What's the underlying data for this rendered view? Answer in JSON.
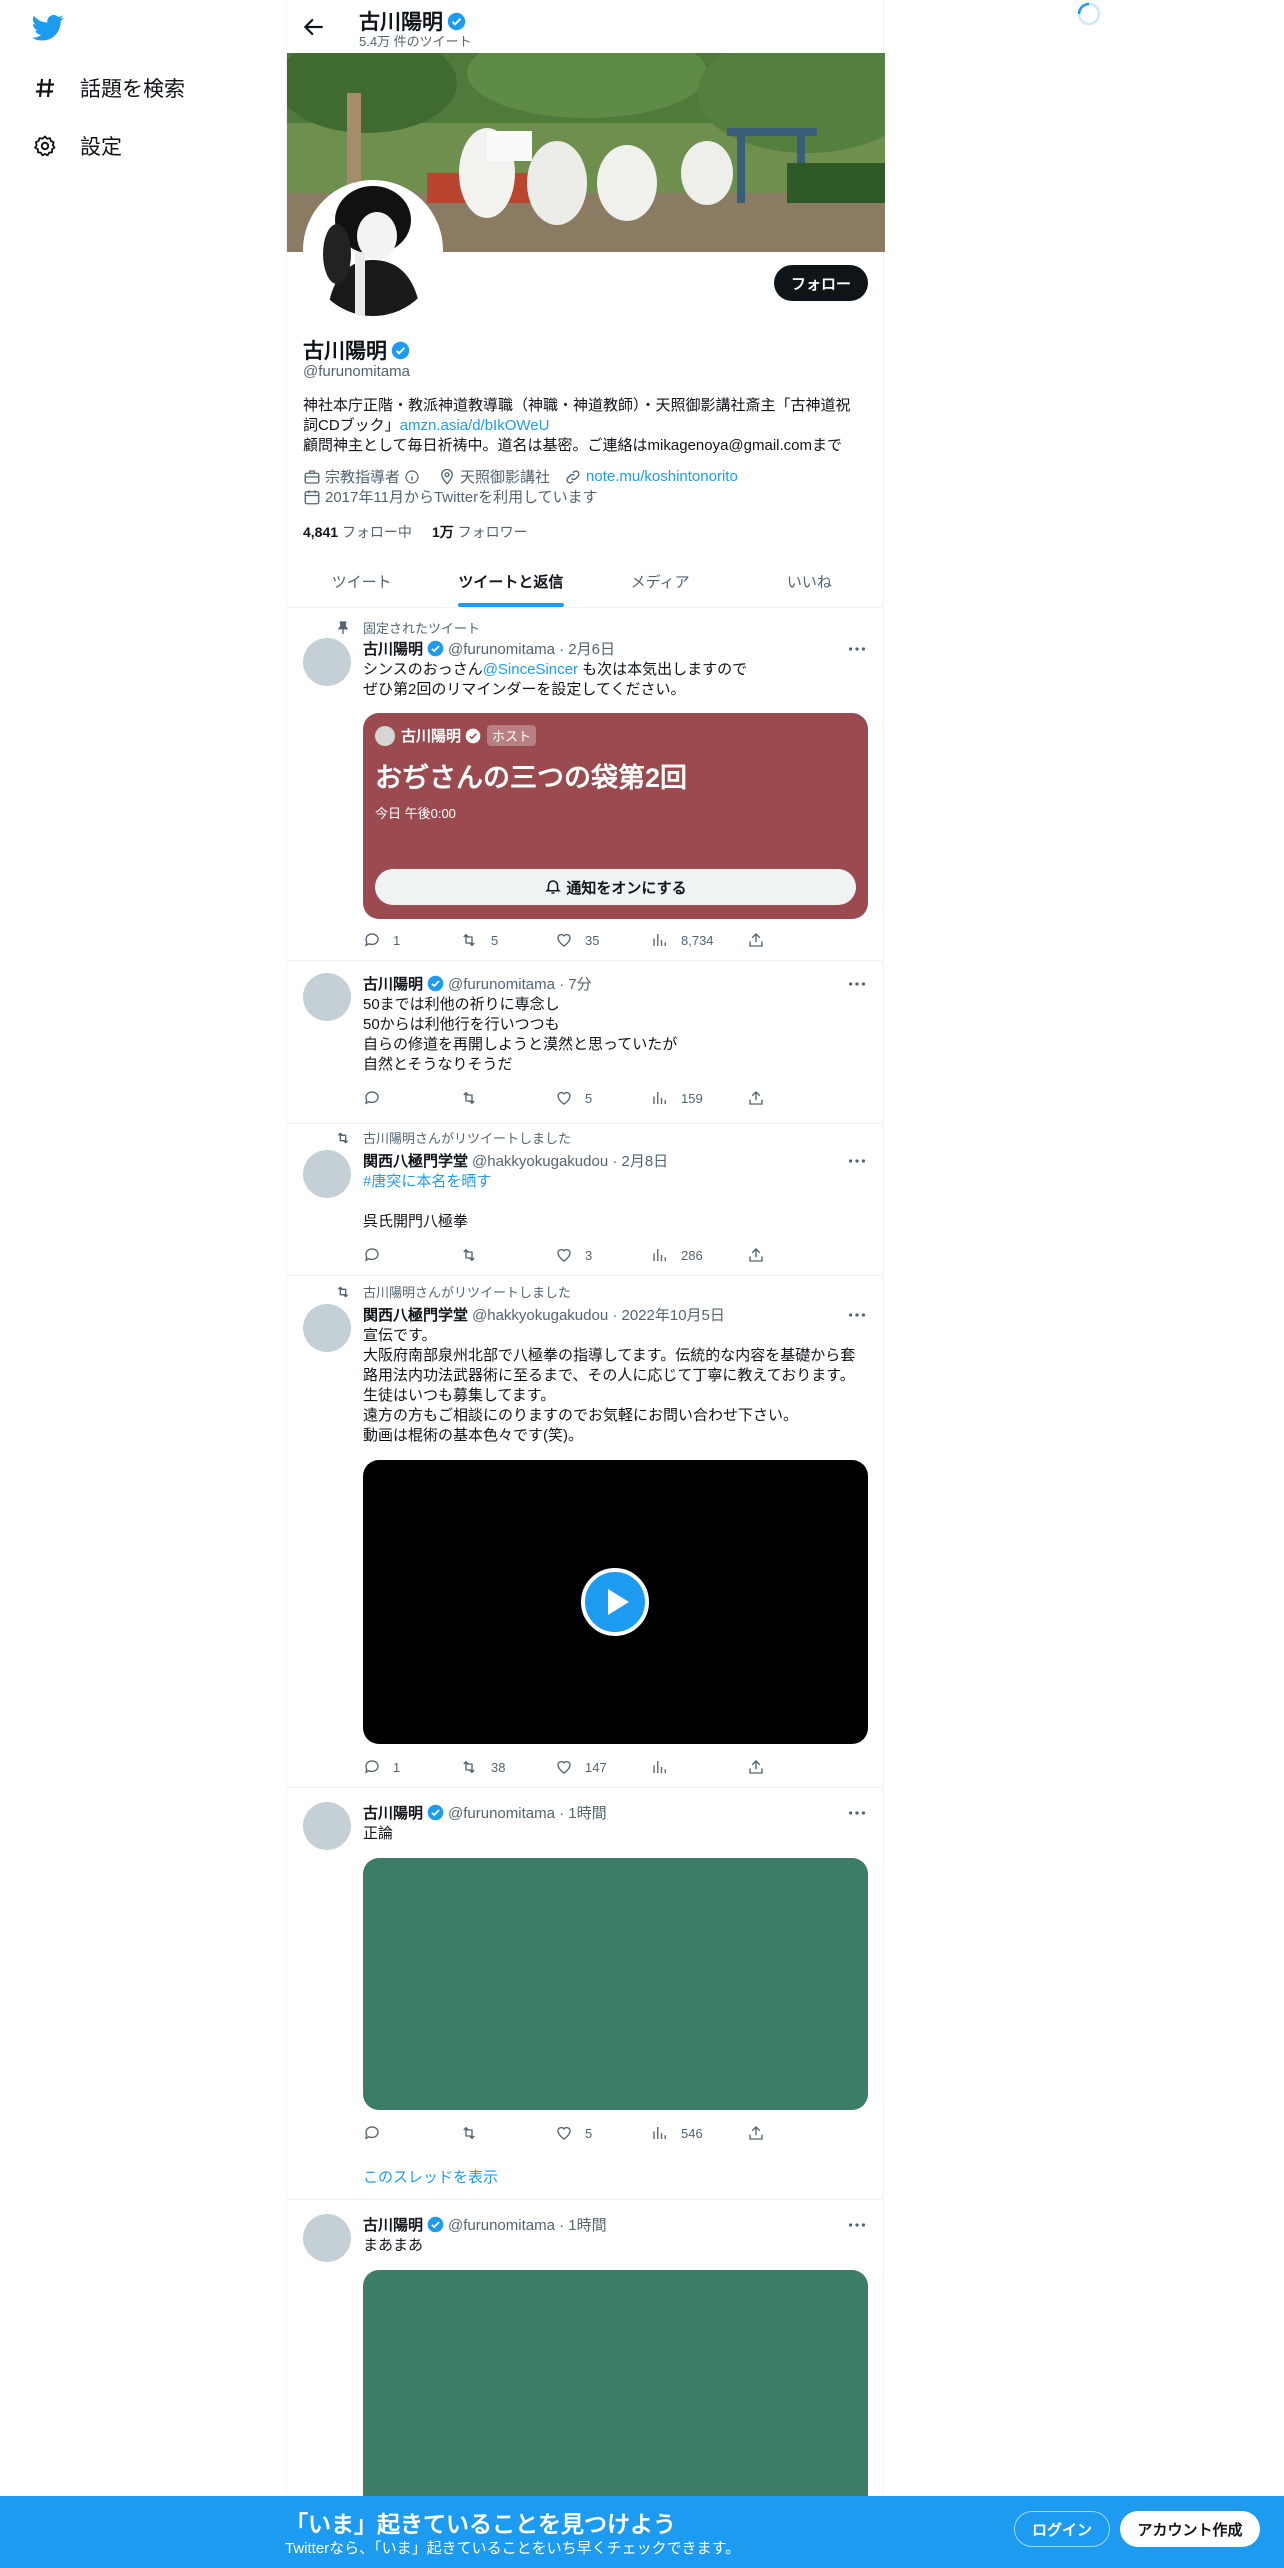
{
  "nav": {
    "explore_label": "話題を検索",
    "settings_label": "設定"
  },
  "header": {
    "name": "古川陽明",
    "tweet_count": "5.4万 件のツイート"
  },
  "profile": {
    "follow_label": "フォロー",
    "name": "古川陽明",
    "handle": "@furunomitama",
    "bio_line1": "神社本庁正階・教派神道教導職（神職・神道教師）・天照御影講社斎主「古神道祝",
    "bio_line2a": "詞CDブック」",
    "bio_link": "amzn.asia/d/bIkOWeU",
    "bio_line3": "顧問神主として毎日祈祷中。道名は基密。ご連絡はmikagenoya@gmail.comまで",
    "category": "宗教指導者",
    "location": "天照御影講社",
    "website": "note.mu/koshintonorito",
    "joined": "2017年11月からTwitterを利用しています",
    "following_count": "4,841",
    "following_label": "フォロー中",
    "followers_count": "1万",
    "followers_label": "フォロワー"
  },
  "tabs": [
    "ツイート",
    "ツイートと返信",
    "メディア",
    "いいね"
  ],
  "tweets": [
    {
      "pinned_label": "固定されたツイート",
      "name": "古川陽明",
      "meta": "@furunomitama · 2月6日",
      "text_a": "シンスのおっさん",
      "mention": "@SinceSincer",
      "text_b": " も次は本気出しますので\nぜひ第2回のリマインダーを設定してください。",
      "card": {
        "host_name": "古川陽明",
        "host_badge": "ホスト",
        "title": "おぢさんの三つの袋第2回",
        "time": "今日 午後0:00",
        "button": "通知をオンにする",
        "color": "#9b4a4f"
      },
      "replies": "1",
      "retweets": "5",
      "likes": "35",
      "views": "8,734"
    },
    {
      "name": "古川陽明",
      "meta": "@furunomitama · 7分",
      "text": "50までは利他の祈りに専念し\n50からは利他行を行いつつも\n自らの修道を再開しようと漠然と思っていたが\n自然とそうなりそうだ",
      "replies": "",
      "retweets": "",
      "likes": "5",
      "views": "159"
    },
    {
      "social": "古川陽明さんがリツイートしました",
      "name": "関西八極門学堂",
      "meta": "@hakkyokugakudou · 2月8日",
      "hashtag": "#唐突に本名を晒す",
      "text": "呉氏開門八極拳",
      "replies": "",
      "retweets": "",
      "likes": "3",
      "views": "286"
    },
    {
      "social": "古川陽明さんがリツイートしました",
      "name": "関西八極門学堂",
      "meta": "@hakkyokugakudou · 2022年10月5日",
      "text": "宣伝です。\n大阪府南部泉州北部で八極拳の指導してます。伝統的な内容を基礎から套\n路用法内功法武器術に至るまで、その人に応じて丁寧に教えております。\n生徒はいつも募集してます。\n遠方の方もご相談にのりますのでお気軽にお問い合わせ下さい。\n動画は棍術の基本色々です(笑)。",
      "replies": "1",
      "retweets": "38",
      "likes": "147",
      "views": ""
    },
    {
      "name": "古川陽明",
      "meta": "@furunomitama · 1時間",
      "text": "正論",
      "media_color": "#3c7d66",
      "replies": "",
      "retweets": "",
      "likes": "5",
      "views": "546",
      "show_thread": "このスレッドを表示"
    },
    {
      "name": "古川陽明",
      "meta": "@furunomitama · 1時間",
      "text": "まあまあ",
      "media_color": "#3c7d66"
    }
  ],
  "bottom_bar": {
    "title": "「いま」起きていることを見つけよう",
    "subtitle": "Twitterなら、「いま」起きていることをいち早くチェックできます。",
    "login": "ログイン",
    "signup": "アカウント作成"
  },
  "colors": {
    "accent": "#1d9bf0",
    "space_card": "#9b4a4f",
    "media_green": "#3c7d66"
  }
}
